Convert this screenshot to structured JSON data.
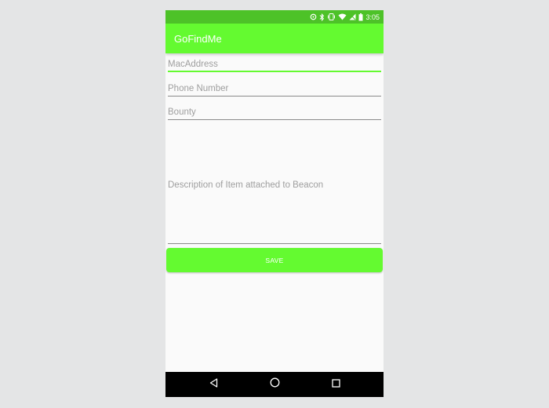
{
  "app": {
    "title": "GoFindMe",
    "primary_color": "#64fa30",
    "status_bar_color": "#4dc228"
  },
  "status_bar": {
    "time": "3:05",
    "icons": [
      "data-saver-icon",
      "bluetooth-icon",
      "vibrate-icon",
      "wifi-icon",
      "cell-signal-icon",
      "battery-icon"
    ]
  },
  "form": {
    "mac_address": {
      "placeholder": "MacAddress",
      "value": ""
    },
    "phone_number": {
      "placeholder": "Phone Number",
      "value": ""
    },
    "bounty": {
      "placeholder": "Bounty",
      "value": ""
    },
    "description": {
      "placeholder": "Description of Item attached to Beacon",
      "value": ""
    },
    "focused_field": "mac_address"
  },
  "actions": {
    "save_label": "SAVE"
  },
  "nav_bar": {
    "icons": [
      "back-icon",
      "home-icon",
      "recents-icon"
    ]
  }
}
